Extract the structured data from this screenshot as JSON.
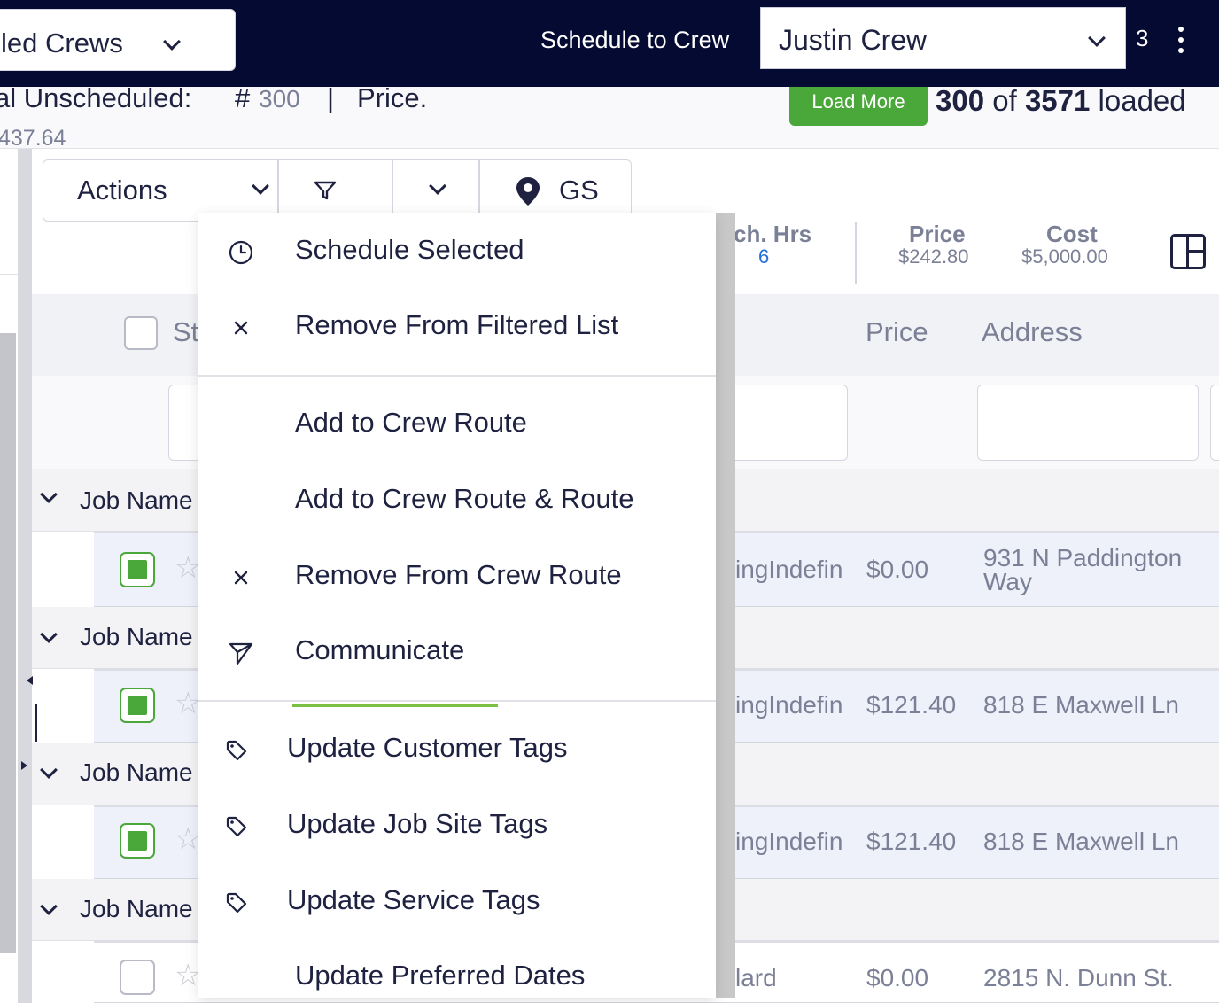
{
  "topbar": {
    "crew_filter_value": "led Crews",
    "schedule_label": "Schedule to Crew",
    "crew_select_value": "Justin Crew",
    "badge_count": "3"
  },
  "summary": {
    "label": "al Unscheduled:",
    "hash": "#",
    "count": "300",
    "separator": "|",
    "price_label": "Price.",
    "amount": "437.64",
    "load_more": "Load More",
    "loaded_count": "300",
    "loaded_of": "of",
    "loaded_total": "3571",
    "loaded_suffix": "loaded"
  },
  "toolbar": {
    "actions_label": "Actions",
    "gs_label": "GS"
  },
  "stats": {
    "hrs_label": "ch. Hrs",
    "hrs_value": "6",
    "price_label": "Price",
    "price_value": "$242.80",
    "cost_label": "Cost",
    "cost_value": "$5,000.00"
  },
  "table": {
    "headers": {
      "status": "St",
      "price": "Price",
      "address": "Address"
    },
    "group_label": "Job Name",
    "rows": [
      {
        "trail": "ingIndefin",
        "price": "$0.00",
        "address_line1": "931 N Paddington",
        "address_line2": "Way"
      },
      {
        "trail": "ingIndefin",
        "price": "$121.40",
        "address_line1": "818 E Maxwell Ln",
        "address_line2": ""
      },
      {
        "trail": "ingIndefin",
        "price": "$121.40",
        "address_line1": "818 E Maxwell Ln",
        "address_line2": ""
      },
      {
        "trail": "lard",
        "price": "$0.00",
        "address_line1": "2815 N. Dunn St.",
        "address_line2": ""
      }
    ]
  },
  "menu": {
    "items": [
      {
        "label": "Schedule Selected",
        "icon": "clock-icon"
      },
      {
        "label": "Remove From Filtered List",
        "icon": "close-icon"
      },
      {
        "label": "Add to Crew Route",
        "icon": ""
      },
      {
        "label": "Add to Crew Route & Route",
        "icon": ""
      },
      {
        "label": "Remove From Crew Route",
        "icon": "close-icon"
      },
      {
        "label": "Communicate",
        "icon": "send-icon"
      },
      {
        "label": "Update Customer Tags",
        "icon": "tag-icon"
      },
      {
        "label": "Update Job Site Tags",
        "icon": "tag-icon"
      },
      {
        "label": "Update Service Tags",
        "icon": "tag-icon"
      },
      {
        "label": "Update Preferred Dates",
        "icon": ""
      }
    ]
  },
  "colors": {
    "navy": "#050a32",
    "accent_green": "#4aa83a",
    "underline_green": "#7cc043",
    "link_blue": "#1f6fd6"
  }
}
